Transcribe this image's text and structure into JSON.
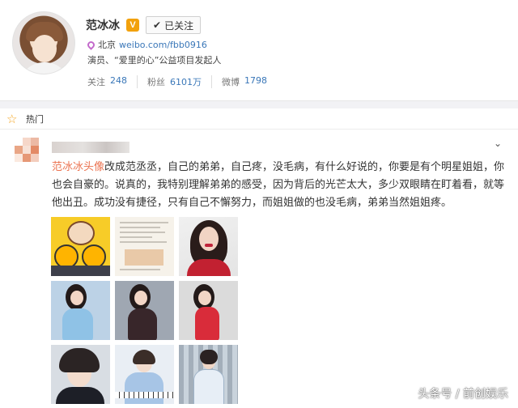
{
  "profile": {
    "name": "范冰冰",
    "verified_badge": "V",
    "follow_button": "已关注",
    "location": "北京",
    "link": "weibo.com/fbb0916",
    "bio": "演员、“爱里的心”公益项目发起人",
    "stats": [
      {
        "label": "关注",
        "value": "248"
      },
      {
        "label": "粉丝",
        "value": "6101万"
      },
      {
        "label": "微博",
        "value": "1798"
      }
    ]
  },
  "hotbar": {
    "label": "热门",
    "icon": "star-icon",
    "color": "#f5a623"
  },
  "post": {
    "link_text": "范冰冰头像",
    "text_part1": "改成范丞丞",
    "text_part2": "，自己的弟弟，自己疼，没毛病，有什么好说的，你要是有个明星姐姐，你也会自豪的。说真的，我特别理解弟弟的感受，因为背后的光芒太大，多少双眼睛在盯着看，就等他出丑。成功没有捷径，只有自己不懈努力，而姐姐做的也没毛病，弟弟当然姐姐疼。",
    "highlight_color": "#eb7350",
    "expand_icon": "chevron-down-icon"
  },
  "photos": [
    {
      "name": "photo-cartoon-avatar"
    },
    {
      "name": "photo-weibo-screenshot"
    },
    {
      "name": "photo-red-dress-portrait"
    },
    {
      "name": "photo-blue-dress"
    },
    {
      "name": "photo-dark-dress"
    },
    {
      "name": "photo-red-sweater"
    },
    {
      "name": "photo-young-man-closeup"
    },
    {
      "name": "photo-young-man-piano"
    },
    {
      "name": "photo-young-man-airport"
    }
  ],
  "watermark": "头条号 / 前创娱乐"
}
